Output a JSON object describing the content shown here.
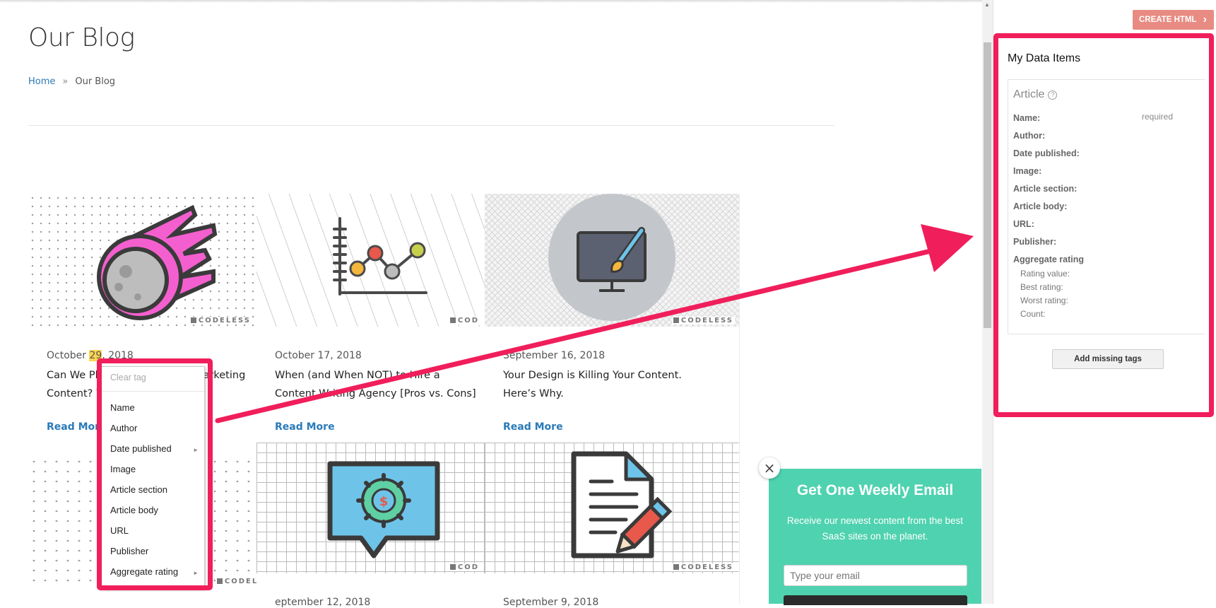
{
  "page": {
    "title": "Our Blog",
    "breadcrumb": {
      "home": "Home",
      "separator": "»",
      "current": "Our Blog"
    }
  },
  "watermark": "CODELESS",
  "watermark_cut": "COD",
  "posts": [
    {
      "date_prefix": "October ",
      "date_day": "29",
      "date_suffix": ", 2018",
      "title_left": "Can We Ple",
      "title_right": "arketing",
      "title_line2": "Content? W",
      "read_more": "Read More"
    },
    {
      "date": "October 17, 2018",
      "title": "When (and When NOT) to Hire a Content Writing Agency [Pros vs. Cons]",
      "read_more": "Read More"
    },
    {
      "date": "September 16, 2018",
      "title": "Your Design is Killing Your Content. Here’s Why.",
      "read_more": "Read More"
    },
    {
      "date": "eptember 12, 2018"
    },
    {
      "date": "September 9, 2018"
    }
  ],
  "context_menu": {
    "clear": "Clear tag",
    "items": [
      {
        "label": "Name"
      },
      {
        "label": "Author"
      },
      {
        "label": "Date published",
        "arrow": "►"
      },
      {
        "label": "Image"
      },
      {
        "label": "Article section"
      },
      {
        "label": "Article body"
      },
      {
        "label": "URL"
      },
      {
        "label": "Publisher"
      },
      {
        "label": "Aggregate rating",
        "arrow": "►"
      }
    ]
  },
  "popup": {
    "close": "×",
    "title": "Get One Weekly Email",
    "description": "Receive our newest content from the best SaaS sites on the planet.",
    "email_placeholder": "Type your email"
  },
  "panel": {
    "create_button": "CREATE HTML",
    "create_chevron": "›",
    "title": "My Data Items",
    "article_title": "Article",
    "help": "?",
    "required": "required",
    "properties": [
      "Name:",
      "Author:",
      "Date published:",
      "Image:",
      "Article section:",
      "Article body:",
      "URL:",
      "Publisher:",
      "Aggregate rating"
    ],
    "rating_fields": [
      "Rating value:",
      "Best rating:",
      "Worst rating:",
      "Count:"
    ],
    "add_missing": "Add missing tags"
  },
  "colors": {
    "annotation": "#f01e5b",
    "link": "#2a7ab8",
    "popup_bg": "#4fd2b0",
    "create_button": "#e88b82",
    "highlight": "#ffd54f"
  }
}
